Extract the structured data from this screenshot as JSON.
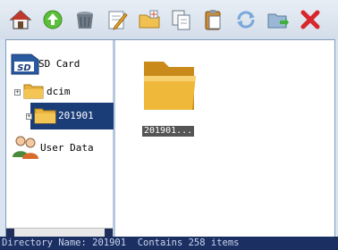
{
  "toolbar": {
    "buttons": [
      {
        "name": "home-icon"
      },
      {
        "name": "up-arrow-icon"
      },
      {
        "name": "trash-icon"
      },
      {
        "name": "edit-icon"
      },
      {
        "name": "new-folder-icon"
      },
      {
        "name": "copy-icon"
      },
      {
        "name": "paste-icon"
      },
      {
        "name": "refresh-icon"
      },
      {
        "name": "move-folder-icon"
      },
      {
        "name": "close-icon"
      }
    ]
  },
  "tree": {
    "items": [
      {
        "label": "SD Card",
        "icon": "sd-card-icon"
      },
      {
        "label": "dcim",
        "icon": "folder-icon",
        "expander": "+"
      },
      {
        "label": "201901",
        "icon": "folder-icon",
        "expander": "+",
        "selected": true
      },
      {
        "label": "User Data",
        "icon": "users-icon"
      }
    ]
  },
  "content": {
    "items": [
      {
        "label": "201901...",
        "icon": "folder-icon"
      }
    ]
  },
  "status": {
    "text": "Directory Name: 201901  Contains 258 items"
  },
  "colors": {
    "statusbar": "#1c2f63",
    "selection": "#1a3d78",
    "folder": "#e8b23c",
    "background": "#d9e4f0"
  }
}
